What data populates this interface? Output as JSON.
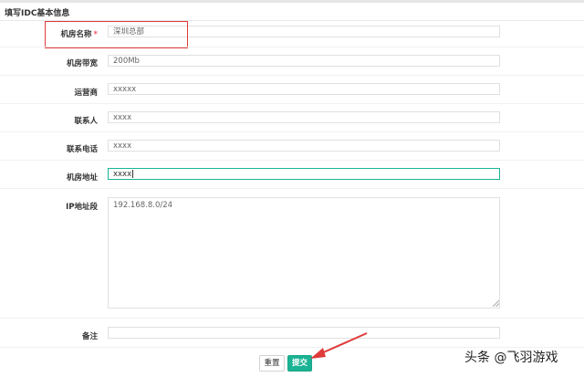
{
  "header": {
    "title": "填写IDC基本信息"
  },
  "form": {
    "name": {
      "label": "机房名称",
      "required_mark": "*",
      "value": "深圳总部"
    },
    "bandwidth": {
      "label": "机房带宽",
      "value": "200Mb"
    },
    "operator": {
      "label": "运营商",
      "value": "xxxxx"
    },
    "contact": {
      "label": "联系人",
      "value": "xxxx"
    },
    "phone": {
      "label": "联系电话",
      "value": "xxxx"
    },
    "address": {
      "label": "机房地址",
      "value": "xxxx"
    },
    "ip_range": {
      "label": "IP地址段",
      "value": "192.168.8.0/24"
    },
    "remark": {
      "label": "备注",
      "value": ""
    }
  },
  "buttons": {
    "reset": "重置",
    "submit": "提交"
  },
  "watermark": {
    "text": "头条 @飞羽游戏"
  },
  "colors": {
    "accent": "#1ab394",
    "required": "#ed5565",
    "highlight": "#e03a3a"
  }
}
